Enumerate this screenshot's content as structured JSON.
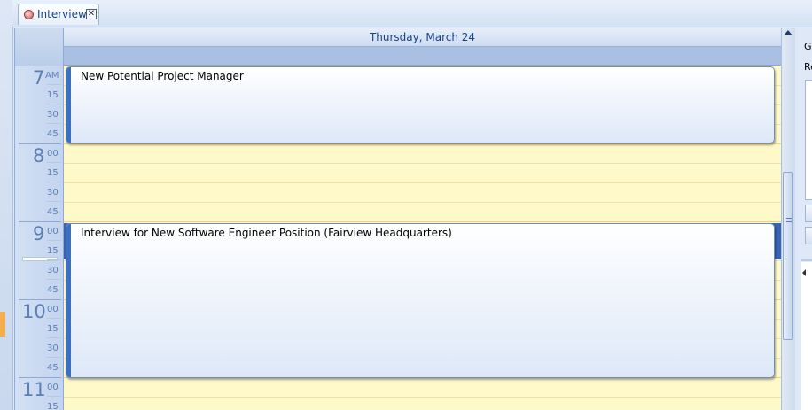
{
  "tab": {
    "label": "Interview",
    "close_label": "✕",
    "icon": "calendar-icon"
  },
  "calendar": {
    "day_header": "Thursday, March 24",
    "hours": [
      {
        "hour": "7",
        "suffix": "AM"
      },
      {
        "hour": "8",
        "suffix": "00"
      },
      {
        "hour": "9",
        "suffix": "00"
      },
      {
        "hour": "10",
        "suffix": "00"
      },
      {
        "hour": "11",
        "suffix": "00"
      }
    ],
    "minute_labels": [
      "15",
      "30",
      "45"
    ],
    "appointments": [
      {
        "subject": "New Potential Project Manager"
      },
      {
        "subject": "Interview for New Software Engineer Position (Fairview Headquarters)"
      }
    ]
  },
  "right_panel": {
    "label_1": "Gr",
    "label_2": "Re"
  },
  "colors": {
    "grid_background": "#fff8c8",
    "selection": "#3863b7",
    "accent": "#15428b"
  }
}
